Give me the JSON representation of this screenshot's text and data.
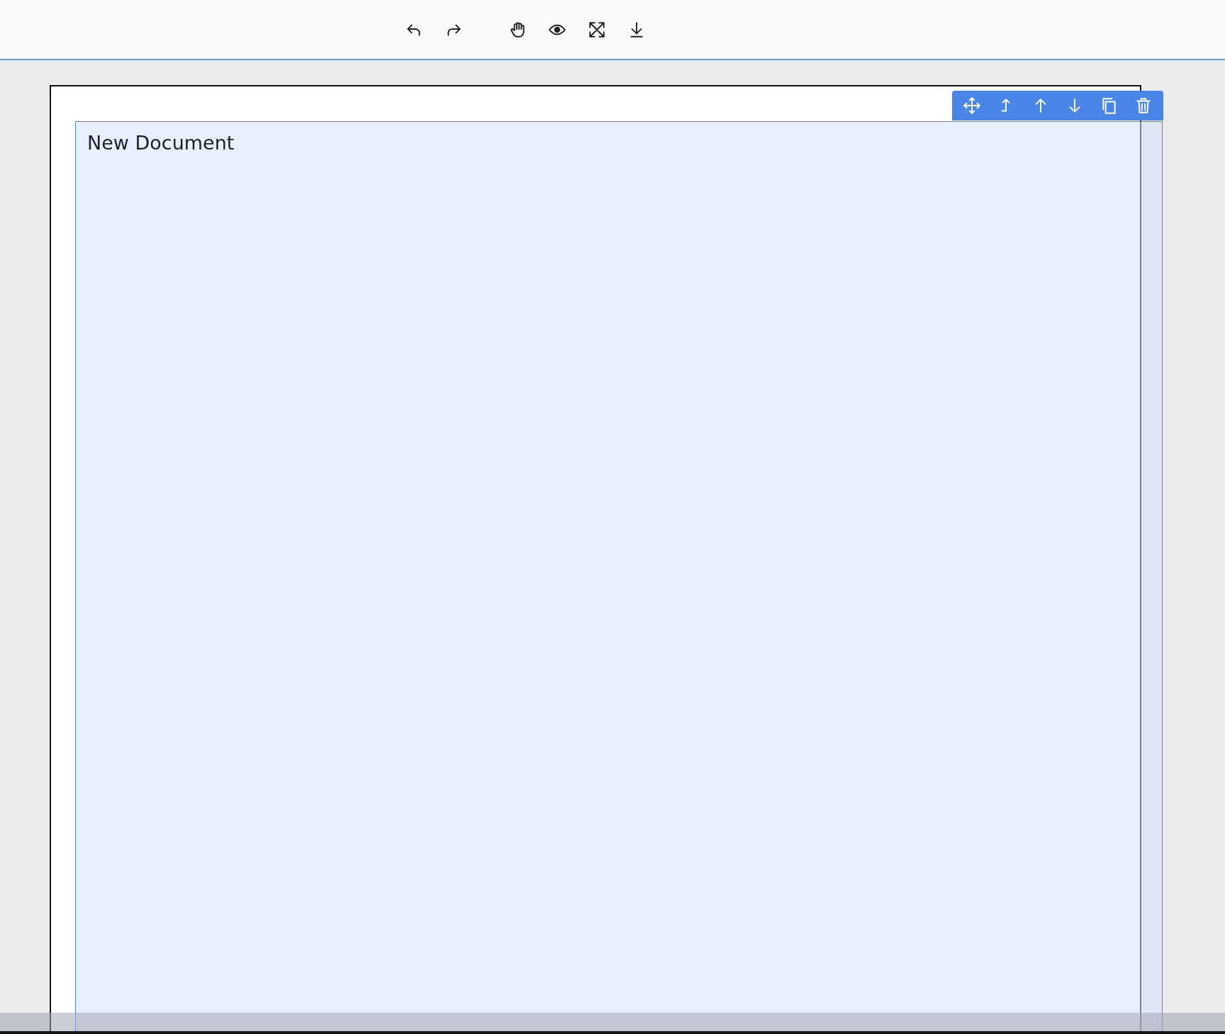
{
  "document": {
    "title": "New Document",
    "selected": true
  }
}
